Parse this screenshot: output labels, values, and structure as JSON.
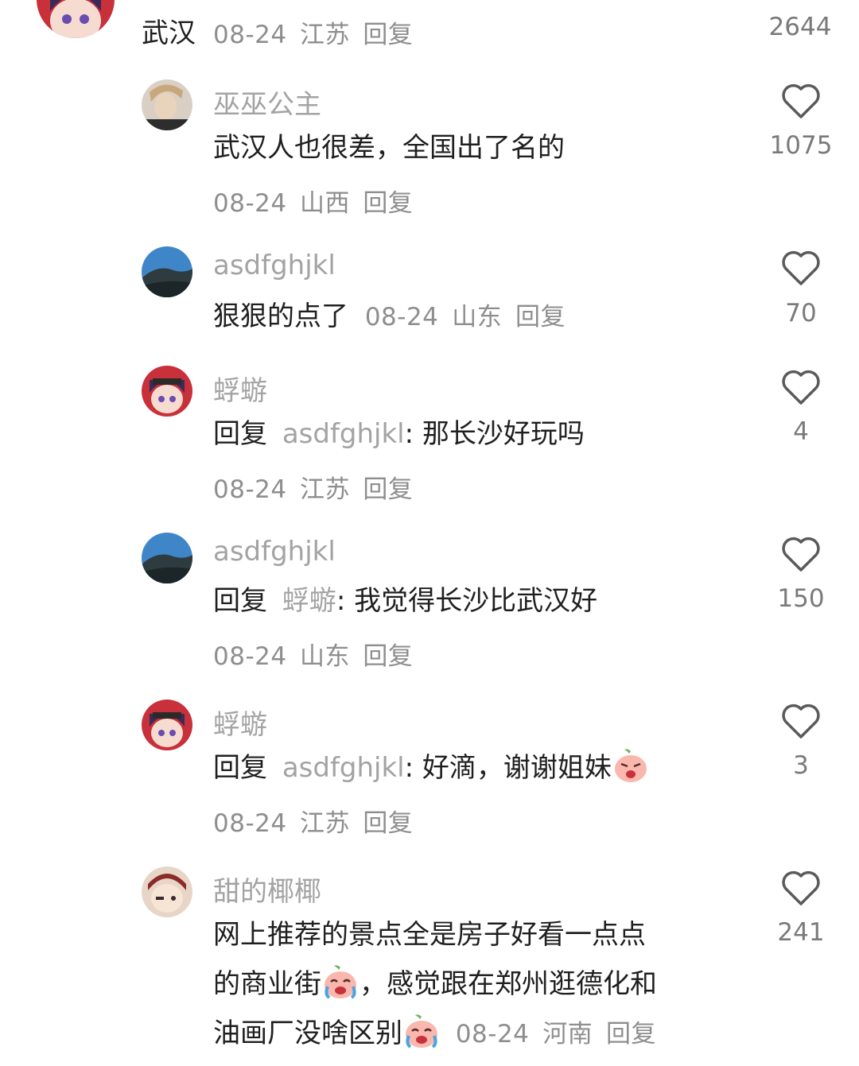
{
  "top_comment": {
    "text": "武汉",
    "date": "08-24",
    "location": "江苏",
    "reply_label": "回复",
    "likes": "2644"
  },
  "replies": [
    {
      "username": "巫巫公主",
      "text": "武汉人也很差，全国出了名的",
      "date": "08-24",
      "location": "山西",
      "reply_label": "回复",
      "likes": "1075"
    },
    {
      "username": "asdfghjkl",
      "text": "狠狠的点了",
      "date": "08-24",
      "location": "山东",
      "reply_label": "回复",
      "likes": "70"
    },
    {
      "username": "蜉蝣",
      "reply_prefix": "回复",
      "reply_to": "asdfghjkl",
      "colon": ":",
      "text": "那长沙好玩吗",
      "date": "08-24",
      "location": "江苏",
      "reply_label": "回复",
      "likes": "4"
    },
    {
      "username": "asdfghjkl",
      "reply_prefix": "回复",
      "reply_to": "蜉蝣",
      "colon": ":",
      "text": "我觉得长沙比武汉好",
      "date": "08-24",
      "location": "山东",
      "reply_label": "回复",
      "likes": "150"
    },
    {
      "username": "蜉蝣",
      "reply_prefix": "回复",
      "reply_to": "asdfghjkl",
      "colon": ":",
      "text": "好滴，谢谢姐妹",
      "emoji": "angry-peach-emoji",
      "date": "08-24",
      "location": "江苏",
      "reply_label": "回复",
      "likes": "3"
    },
    {
      "username": "甜的椰椰",
      "text_line1": "网上推荐的景点全是房子好看一点点",
      "text_line2a": "的商业街",
      "text_line2b": "，感觉跟在郑州逛德化和",
      "text_line3": "油画厂没啥区别",
      "emoji": "crying-peach-emoji",
      "date": "08-24",
      "location": "河南",
      "reply_label": "回复",
      "likes": "241"
    }
  ],
  "icons": {
    "like": "heart-outline-icon"
  },
  "colors": {
    "username_gray": "#a3a3a3",
    "meta_gray": "#8e8e8e",
    "text_dark": "#1f1f1f"
  }
}
